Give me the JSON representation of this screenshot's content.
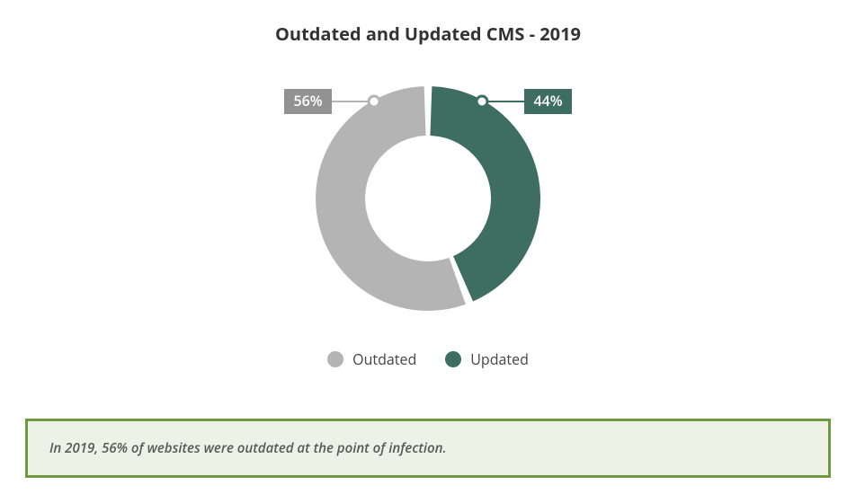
{
  "title": "Outdated and Updated CMS - 2019",
  "caption": "In 2019, 56% of websites were outdated at the point of infection.",
  "colors": {
    "outdated": "#b4b4b4",
    "updated": "#3e6e60",
    "label_bg_outdated": "#929292",
    "label_bg_updated": "#3e6e60",
    "caption_border": "#6f9a3f",
    "caption_bg": "#eef2e6"
  },
  "legend": {
    "outdated": "Outdated",
    "updated": "Updated"
  },
  "labels": {
    "outdated": "56%",
    "updated": "44%"
  },
  "chart_data": {
    "type": "pie",
    "title": "Outdated and Updated CMS - 2019",
    "categories": [
      "Outdated",
      "Updated"
    ],
    "values": [
      56,
      44
    ],
    "series": [
      {
        "name": "Outdated",
        "value": 56,
        "color": "#b4b4b4"
      },
      {
        "name": "Updated",
        "value": 44,
        "color": "#3e6e60"
      }
    ]
  }
}
